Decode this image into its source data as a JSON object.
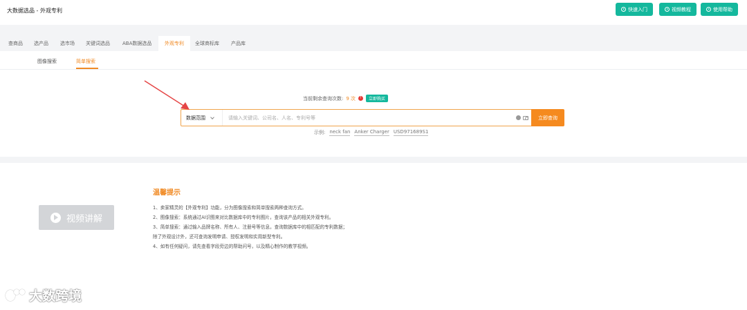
{
  "header": {
    "app_title": "大数据选品 - 外观专利",
    "buttons": [
      {
        "label": "快速入门"
      },
      {
        "label": "视频教程"
      },
      {
        "label": "使用帮助"
      }
    ]
  },
  "tabs": [
    {
      "label": "查商品"
    },
    {
      "label": "选产品"
    },
    {
      "label": "选市场"
    },
    {
      "label": "关键词选品"
    },
    {
      "label": "ABA数据选品"
    },
    {
      "label": "外观专利",
      "active": true
    },
    {
      "label": "全球商标库"
    },
    {
      "label": "产品库"
    }
  ],
  "subtabs": [
    {
      "label": "图像搜索"
    },
    {
      "label": "简单搜索",
      "active": true
    }
  ],
  "quota": {
    "prefix": "当前剩余查询次数:",
    "count": "9 次",
    "buy_label": "立即购买"
  },
  "search": {
    "scope_label": "数据范围",
    "placeholder": "请输入关键词、公司名、人名、专利号等",
    "button_label": "立即查询"
  },
  "examples": {
    "prefix": "示例:",
    "items": [
      "neck fan",
      "Anker Charger",
      "USD971689S1"
    ]
  },
  "video": {
    "label": "视频讲解"
  },
  "tips": {
    "title": "温馨提示",
    "lines": [
      "1、卖家精灵的【外观专利】功能，分为图像搜索和简单搜索两种查询方式。",
      "2、图像搜索：系统通过AI识图来对比数据库中的专利图片，查询该产品的相关外观专利。",
      "3、简单搜索：通过输入品牌名称、所有人、注册号等信息，查询数据库中的相匹配的专利数据；",
      "除了外观设计外，还可查询发明申请、授权发明和实用新型专利。",
      "4、如有任何疑问，请先查看字段旁边的帮助问号，以及精心制作的教学视频。"
    ]
  },
  "watermark": {
    "text": "大数跨境"
  },
  "colors": {
    "accent": "#f08a24",
    "teal": "#14b89d",
    "search_button": "#f58a1f",
    "arrow": "#e54545"
  }
}
